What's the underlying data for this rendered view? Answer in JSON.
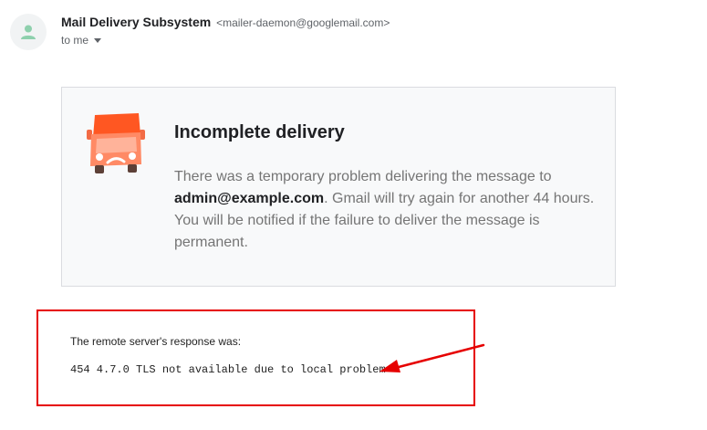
{
  "header": {
    "sender_name": "Mail Delivery Subsystem",
    "sender_email": "<mailer-daemon@googlemail.com>",
    "recipient_label": "to me",
    "avatar_icon": "person-icon",
    "caret_icon": "caret-down-icon"
  },
  "notice": {
    "icon": "sad-truck-icon",
    "title": "Incomplete delivery",
    "body_prefix": "There was a temporary problem delivering the message to ",
    "body_recipient": "admin@example.com",
    "body_suffix": ". Gmail will try again for another 44 hours. You will be notified if the failure to deliver the message is permanent."
  },
  "response": {
    "label": "The remote server's response was:",
    "code": "454 4.7.0 TLS not available due to local problem"
  },
  "annotation": {
    "color": "#e60000"
  }
}
